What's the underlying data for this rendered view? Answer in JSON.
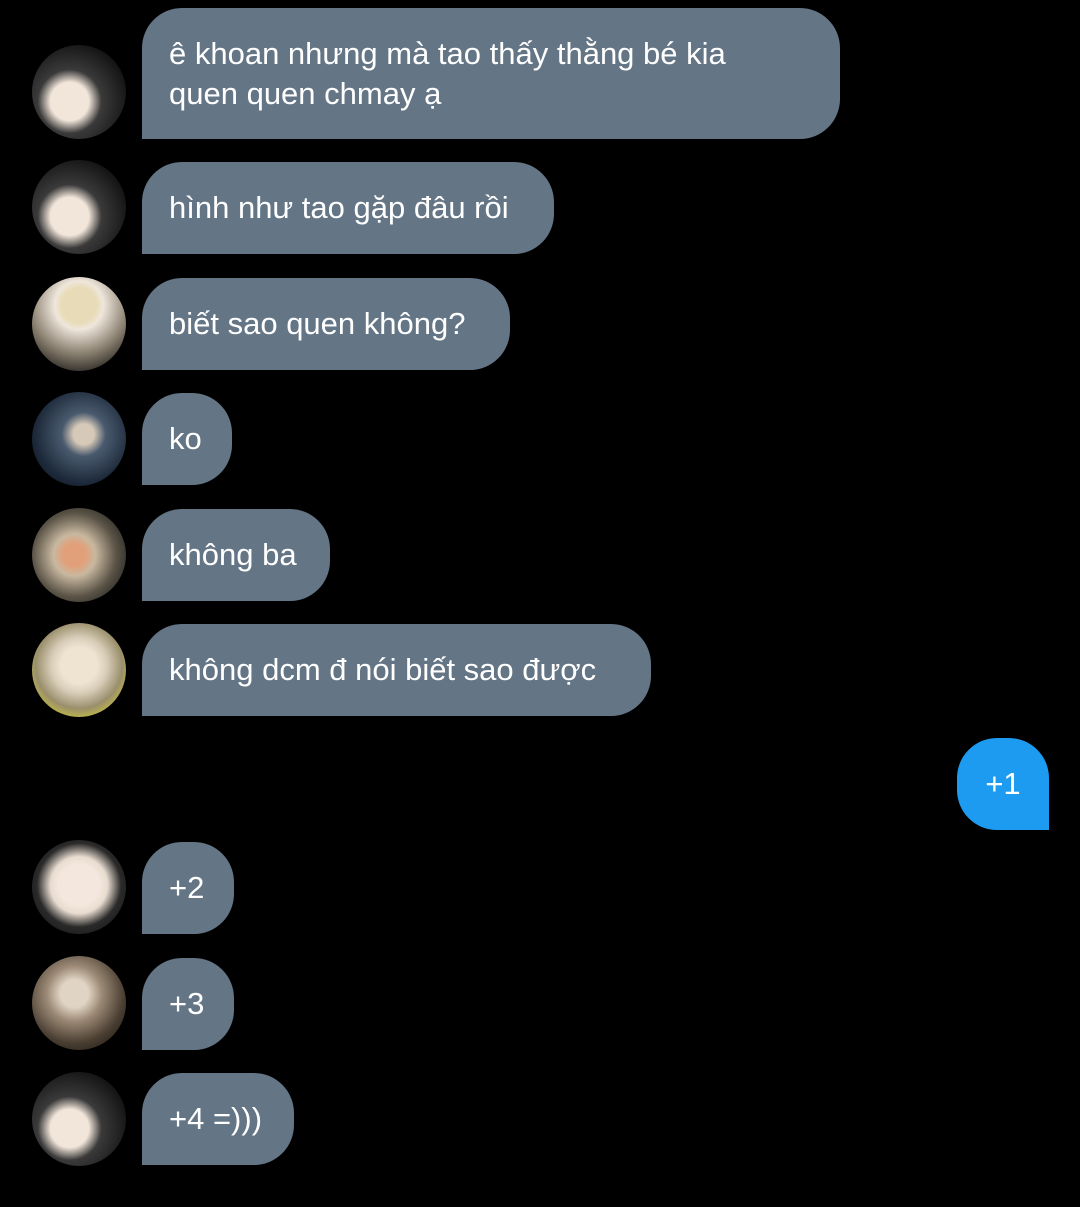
{
  "colors": {
    "background": "#000000",
    "incoming_bubble": "#647585",
    "outgoing_bubble": "#1d9bf0",
    "text": "#ffffff"
  },
  "messages": [
    {
      "direction": "incoming",
      "sender_avatar": "avatar-icon",
      "text_line1": "ê khoan nhưng mà tao thấy thằng bé kia",
      "text_line2": "quen quen chmay ạ"
    },
    {
      "direction": "incoming",
      "sender_avatar": "avatar-icon",
      "text": "hình như tao gặp đâu rồi"
    },
    {
      "direction": "incoming",
      "sender_avatar": "avatar-icon",
      "text": "biết sao quen không?"
    },
    {
      "direction": "incoming",
      "sender_avatar": "avatar-icon",
      "text": "ko"
    },
    {
      "direction": "incoming",
      "sender_avatar": "avatar-icon",
      "text": "không ba"
    },
    {
      "direction": "incoming",
      "sender_avatar": "avatar-icon",
      "text": "không dcm đ nói biết sao được"
    },
    {
      "direction": "outgoing",
      "text": "+1"
    },
    {
      "direction": "incoming",
      "sender_avatar": "avatar-icon",
      "text": "+2"
    },
    {
      "direction": "incoming",
      "sender_avatar": "avatar-icon",
      "text": "+3"
    },
    {
      "direction": "incoming",
      "sender_avatar": "avatar-icon",
      "text": "+4 =)))"
    }
  ]
}
